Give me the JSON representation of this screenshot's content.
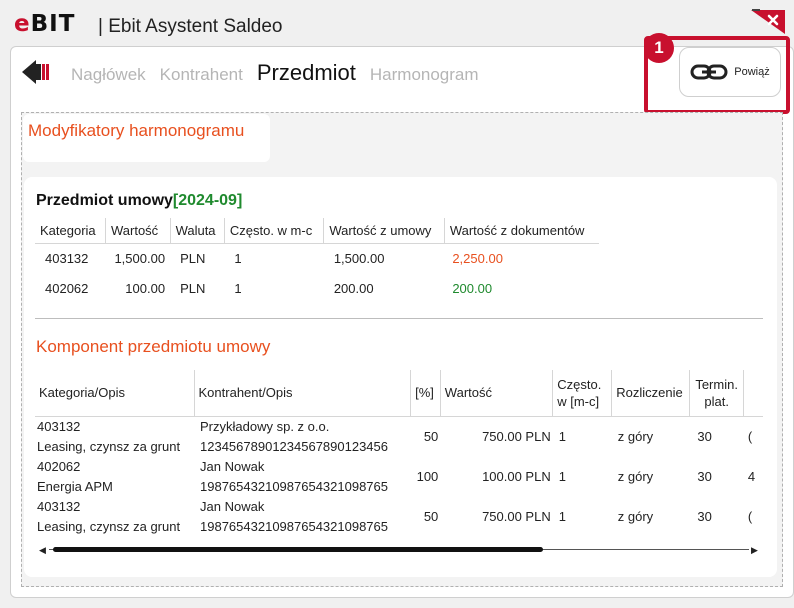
{
  "app": {
    "logo_text": "BIT",
    "logo_e": "e",
    "title": "| Ebit Asystent Saldeo"
  },
  "nav": {
    "tabs": [
      {
        "label": "Nagłówek",
        "active": false
      },
      {
        "label": "Kontrahent",
        "active": false
      },
      {
        "label": "Przedmiot",
        "active": true
      },
      {
        "label": "Harmonogram",
        "active": false
      }
    ]
  },
  "toolbar": {
    "link_label": "Powiąż",
    "badge": "1"
  },
  "modifiers": {
    "title": "Modyfikatory harmonogramu"
  },
  "subject": {
    "title": "Przedmiot umowy",
    "period": "[2024-09]",
    "columns": [
      "Kategoria",
      "Wartość",
      "Waluta",
      "Często. w m-c",
      "Wartość z umowy",
      "Wartość z dokumentów"
    ],
    "rows": [
      {
        "kategoria": "403132",
        "wartosc": "1,500.00",
        "waluta": "PLN",
        "czesto": "1",
        "z_umowy": "1,500.00",
        "z_dokumentow": "2,250.00",
        "status": "over"
      },
      {
        "kategoria": "402062",
        "wartosc": "100.00",
        "waluta": "PLN",
        "czesto": "1",
        "z_umowy": "200.00",
        "z_dokumentow": "200.00",
        "status": "ok"
      }
    ]
  },
  "components": {
    "title": "Komponent przedmiotu umowy",
    "columns": [
      "Kategoria/Opis",
      "Kontrahent/Opis",
      "[%]",
      "Wartość",
      "Często. w [m-c]",
      "Rozliczenie",
      "Termin. plat."
    ],
    "rows": [
      {
        "kategoria": "403132",
        "opis": "Leasing, czynsz za grunt",
        "kontrahent": "Przykładowy sp. z o.o.",
        "konto": "12345678901234567890123456",
        "procent": "50",
        "wartosc": "750.00 PLN",
        "czesto": "1",
        "rozliczenie": "z góry",
        "termin": "30",
        "extra": "("
      },
      {
        "kategoria": "402062",
        "opis": "Energia APM",
        "kontrahent": "Jan Nowak",
        "konto": "19876543210987654321098765",
        "procent": "100",
        "wartosc": "100.00 PLN",
        "czesto": "1",
        "rozliczenie": "z góry",
        "termin": "30",
        "extra": "4"
      },
      {
        "kategoria": "403132",
        "opis": "Leasing, czynsz za grunt",
        "kontrahent": "Jan Nowak",
        "konto": "19876543210987654321098765",
        "procent": "50",
        "wartosc": "750.00 PLN",
        "czesto": "1",
        "rozliczenie": "z góry",
        "termin": "30",
        "extra": "("
      }
    ],
    "scroll_position": 0.7
  },
  "colors": {
    "accent_red": "#c8102e",
    "orange": "#e8501f",
    "green": "#1f8a2e"
  }
}
